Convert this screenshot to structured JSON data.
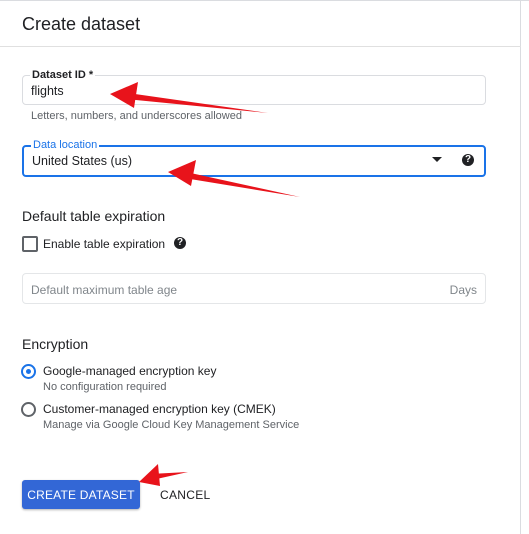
{
  "dialog": {
    "title": "Create dataset"
  },
  "dataset_id": {
    "label": "Dataset ID *",
    "value": "flights",
    "hint": "Letters, numbers, and underscores allowed"
  },
  "data_location": {
    "label": "Data location",
    "selected": "United States (us)"
  },
  "expiration": {
    "section_title": "Default table expiration",
    "checkbox_label": "Enable table expiration",
    "checked": false,
    "max_age_placeholder": "Default maximum table age",
    "max_age_suffix": "Days"
  },
  "encryption": {
    "section_title": "Encryption",
    "options": [
      {
        "label": "Google-managed encryption key",
        "sub": "No configuration required",
        "selected": true
      },
      {
        "label": "Customer-managed encryption key (CMEK)",
        "sub": "Manage via Google Cloud Key Management Service",
        "selected": false
      }
    ]
  },
  "actions": {
    "create_label": "CREATE DATASET",
    "cancel_label": "CANCEL"
  },
  "colors": {
    "accent": "#1a73e8",
    "primary_button": "#3367d6",
    "annotation_arrow": "#e8131b"
  },
  "icons": {
    "help": "help-circle-icon",
    "dropdown": "caret-down-icon"
  }
}
